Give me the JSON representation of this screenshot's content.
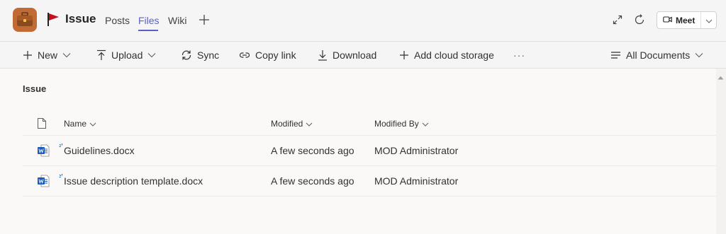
{
  "header": {
    "channel_name": "Issue",
    "tabs": [
      {
        "label": "Posts",
        "active": false
      },
      {
        "label": "Files",
        "active": true
      },
      {
        "label": "Wiki",
        "active": false
      }
    ],
    "meet_label": "Meet"
  },
  "commands": [
    {
      "label": "New",
      "icon": "plus-icon",
      "has_dropdown": true
    },
    {
      "label": "Upload",
      "icon": "upload-icon",
      "has_dropdown": true
    },
    {
      "label": "Sync",
      "icon": "sync-icon",
      "has_dropdown": false
    },
    {
      "label": "Copy link",
      "icon": "link-icon",
      "has_dropdown": false
    },
    {
      "label": "Download",
      "icon": "download-icon",
      "has_dropdown": false
    },
    {
      "label": "Add cloud storage",
      "icon": "plus-icon",
      "has_dropdown": false
    },
    {
      "label": "···",
      "icon": "more-icon",
      "has_dropdown": false
    }
  ],
  "view": {
    "label": "All Documents"
  },
  "breadcrumb": "Issue",
  "columns": {
    "name": "Name",
    "modified": "Modified",
    "modified_by": "Modified By"
  },
  "files": [
    {
      "name": "Guidelines.docx",
      "modified": "A few seconds ago",
      "modified_by": "MOD Administrator",
      "icon": "word-doc-icon"
    },
    {
      "name": "Issue description template.docx",
      "modified": "A few seconds ago",
      "modified_by": "MOD Administrator",
      "icon": "word-doc-icon"
    }
  ],
  "colors": {
    "accent": "#5b5fc7",
    "word_blue": "#185abd",
    "sync_blue": "#0078d4",
    "flag_red": "#c50f1f"
  }
}
